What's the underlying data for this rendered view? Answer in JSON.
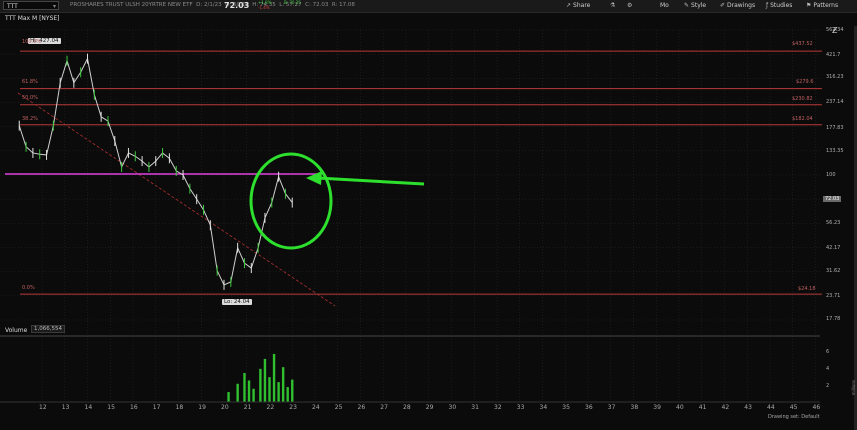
{
  "topbar": {
    "symbol": "TTT",
    "description": "PROSHARES TRUST ULSH 20YRTRE NEW ETF",
    "date": "D: 2/1/23",
    "open": "O: 60.16",
    "high": "H: 74.35",
    "low": "L: 57.27",
    "close": "C: 72.03",
    "range": "R: 17.08",
    "last": "72.03",
    "bid": "B: 70.25",
    "change_up": "+1.8%",
    "change_dn": "-1.4%",
    "tools": [
      "Share",
      "Mo",
      "Style",
      "Drawings",
      "Studies",
      "Patterns"
    ]
  },
  "chart": {
    "title": "TTT Max M [NYSE]",
    "hi_label": "Hi: 427.04",
    "lo_label": "Lo: 24.04",
    "current_badge": "72.03",
    "volume_label": "Volume",
    "volume_value": "1,066,554",
    "fib": [
      {
        "pct": "100.0%",
        "val": "$437.52"
      },
      {
        "pct": "61.8%",
        "val": "$279.6"
      },
      {
        "pct": "50.0%",
        "val": "$230.82"
      },
      {
        "pct": "38.2%",
        "val": "$182.04"
      },
      {
        "pct": "0.0%",
        "val": "$24.18"
      }
    ],
    "y_ticks": [
      "562.34",
      "421.7",
      "316.23",
      "237.14",
      "177.83",
      "133.35",
      "100",
      "75",
      "56.23",
      "42.17",
      "31.62",
      "23.71",
      "17.78"
    ],
    "vol_ticks": [
      "6",
      "4",
      "2"
    ],
    "vol_axis_label": "millions",
    "x_ticks": [
      "12",
      "13",
      "14",
      "15",
      "16",
      "17",
      "18",
      "19",
      "20",
      "21",
      "22",
      "23",
      "24",
      "25",
      "26",
      "27",
      "28",
      "29",
      "30",
      "31",
      "32",
      "33",
      "34",
      "35",
      "36",
      "37",
      "38",
      "39",
      "40",
      "41",
      "42",
      "43",
      "44",
      "45",
      "46"
    ],
    "drawing_set": "Drawing set: Default"
  },
  "chart_data": {
    "type": "line",
    "ylim": [
      17.78,
      562.34
    ],
    "yscale": "log",
    "x": [
      11.0,
      11.3,
      11.6,
      11.9,
      12.2,
      12.5,
      12.8,
      13.1,
      13.4,
      13.7,
      14.0,
      14.3,
      14.6,
      14.9,
      15.2,
      15.5,
      15.8,
      16.1,
      16.4,
      16.7,
      17.0,
      17.3,
      17.6,
      17.9,
      18.2,
      18.5,
      18.8,
      19.1,
      19.4,
      19.7,
      20.0,
      20.3,
      20.6,
      20.9,
      21.2,
      21.5,
      21.8,
      22.1,
      22.4,
      22.7,
      23.0
    ],
    "y": [
      180,
      140,
      130,
      128,
      127,
      180,
      300,
      390,
      300,
      340,
      400,
      260,
      200,
      190,
      150,
      110,
      130,
      125,
      118,
      110,
      118,
      130,
      122,
      105,
      100,
      85,
      75,
      66,
      55,
      32,
      27,
      28,
      42,
      35,
      33,
      42,
      60,
      72,
      98,
      80,
      72
    ]
  }
}
